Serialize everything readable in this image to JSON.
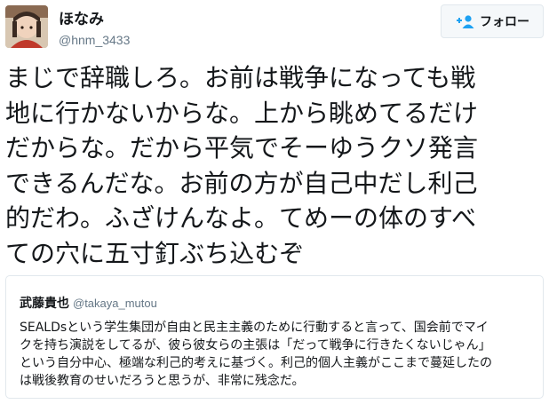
{
  "user": {
    "display_name": "ほなみ",
    "handle": "@hnm_3433"
  },
  "follow_button": {
    "label": "フォロー",
    "icon": "add-person-icon",
    "accent": "#1da1f2"
  },
  "tweet": {
    "lines": [
      "まじで辞職しろ。お前は戦争になっても戦",
      "地に行かないからな。上から眺めてるだけ",
      "だからな。だから平気でそーゆうクソ発言",
      "できるんだな。お前の方が自己中だし利己",
      "的だわ。ふざけんなよ。てめーの体のすべ",
      "ての穴に五寸釘ぶち込むぞ"
    ]
  },
  "quoted_tweet": {
    "display_name": "武藤貴也",
    "handle": "@takaya_mutou",
    "lines": [
      "SEALDsという学生集団が自由と民主主義のために行動すると言って、国会前でマイ",
      "クを持ち演説をしてるが、彼ら彼女らの主張は「だって戦争に行きたくないじゃん」",
      "という自分中心、極端な利己的考えに基づく。利己的個人主義がここまで蔓延したの",
      "は戦後教育のせいだろうと思うが、非常に残念だ。"
    ]
  }
}
